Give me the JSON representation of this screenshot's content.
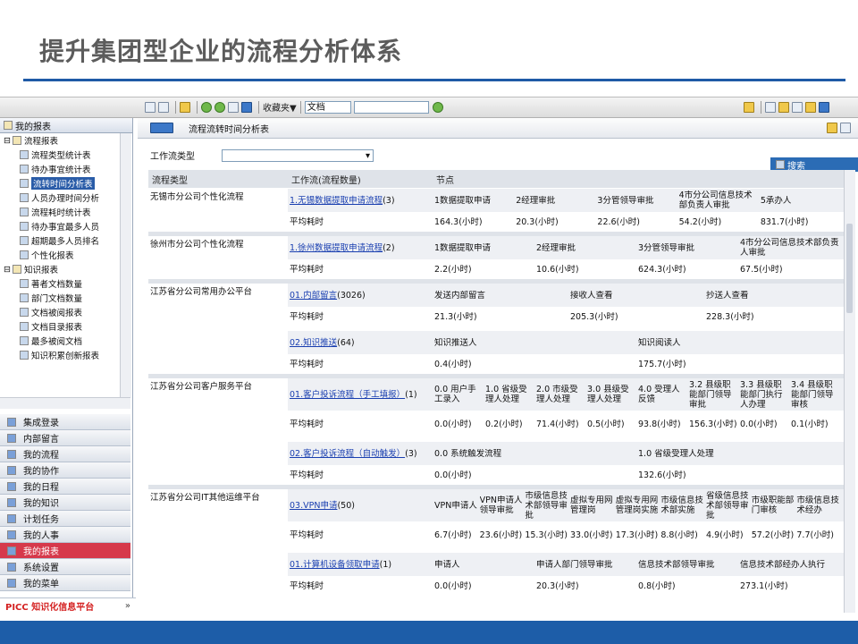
{
  "slide": {
    "title": "提升集团型企业的流程分析体系"
  },
  "toolbar": {
    "favorites": "收藏夹▼",
    "doc_select": "文档"
  },
  "sidebar": {
    "header": "我的报表",
    "tree": [
      {
        "label": "流程报表",
        "indent": 0,
        "icon": "folder-icon"
      },
      {
        "label": "流程类型统计表",
        "indent": 1,
        "icon": "chart-icon"
      },
      {
        "label": "待办事宜统计表",
        "indent": 1,
        "icon": "todo-icon"
      },
      {
        "label": "流转时间分析表",
        "indent": 1,
        "icon": "report-icon",
        "selected": true
      },
      {
        "label": "人员办理时间分析",
        "indent": 1,
        "icon": "user-icon"
      },
      {
        "label": "流程耗时统计表",
        "indent": 1,
        "icon": "report-icon"
      },
      {
        "label": "待办事宜最多人员",
        "indent": 1,
        "icon": "todo-icon"
      },
      {
        "label": "超期最多人员排名",
        "indent": 1,
        "icon": "user-icon"
      },
      {
        "label": "个性化报表",
        "indent": 1,
        "icon": "report-icon"
      },
      {
        "label": "知识报表",
        "indent": 0,
        "icon": "folder-icon"
      },
      {
        "label": "著者文档数量",
        "indent": 1,
        "icon": "user-icon"
      },
      {
        "label": "部门文档数量",
        "indent": 1,
        "icon": "group-icon"
      },
      {
        "label": "文档被阅报表",
        "indent": 1,
        "icon": "report-icon"
      },
      {
        "label": "文档目录报表",
        "indent": 1,
        "icon": "list-icon"
      },
      {
        "label": "最多被阅文档",
        "indent": 1,
        "icon": "report-icon"
      },
      {
        "label": "知识积累创新报表",
        "indent": 1,
        "icon": "report-icon"
      }
    ],
    "nav": [
      {
        "label": "集成登录",
        "active": false
      },
      {
        "label": "内部留言",
        "active": false
      },
      {
        "label": "我的流程",
        "active": false
      },
      {
        "label": "我的协作",
        "active": false
      },
      {
        "label": "我的日程",
        "active": false
      },
      {
        "label": "我的知识",
        "active": false
      },
      {
        "label": "计划任务",
        "active": false
      },
      {
        "label": "我的人事",
        "active": false
      },
      {
        "label": "我的报表",
        "active": true
      },
      {
        "label": "系统设置",
        "active": false
      },
      {
        "label": "我的菜单",
        "active": false
      }
    ],
    "brand": "PICC 知识化信息平台",
    "brand_arrow": "»"
  },
  "main": {
    "title": "流程流转时间分析表",
    "filter_label": "工作流类型",
    "search_label": "搜索",
    "columns": [
      "流程类型",
      "工作流(流程数量)",
      "节点"
    ],
    "groups": [
      {
        "type": "无锡市分公司个性化流程",
        "workflows": [
          {
            "name": "1.无锡数据提取申请流程",
            "count": "(3)",
            "nodes": [
              "1数据提取申请",
              "2经理审批",
              "3分管领导审批",
              "4市分公司信息技术部负责人审批",
              "5承办人"
            ],
            "avg_label": "平均耗时",
            "times": [
              "164.3(小时)",
              "20.3(小时)",
              "22.6(小时)",
              "54.2(小时)",
              "831.7(小时)"
            ]
          }
        ]
      },
      {
        "type": "徐州市分公司个性化流程",
        "workflows": [
          {
            "name": "1.徐州数据提取申请流程",
            "count": "(2)",
            "nodes": [
              "1数据提取申请",
              "2经理审批",
              "3分管领导审批",
              "4市分公司信息技术部负责人审批"
            ],
            "avg_label": "平均耗时",
            "times": [
              "2.2(小时)",
              "10.6(小时)",
              "624.3(小时)",
              "67.5(小时)"
            ]
          }
        ]
      },
      {
        "type": "江苏省分公司常用办公平台",
        "workflows": [
          {
            "name": "01.内部留言",
            "count": "(3026)",
            "nodes": [
              "发送内部留言",
              "接收人查看",
              "抄送人查看"
            ],
            "avg_label": "平均耗时",
            "times": [
              "21.3(小时)",
              "205.3(小时)",
              "228.3(小时)"
            ]
          },
          {
            "name": "02.知识推送",
            "count": "(64)",
            "nodes": [
              "知识推送人",
              "知识阅读人"
            ],
            "avg_label": "平均耗时",
            "times": [
              "0.4(小时)",
              "175.7(小时)"
            ]
          }
        ]
      },
      {
        "type": "江苏省分公司客户服务平台",
        "workflows": [
          {
            "name": "01.客户投诉流程（手工填报）",
            "count": "(1)",
            "nodes": [
              "0.0 用户手工录入",
              "1.0 省级受理人处理",
              "2.0 市级受理人处理",
              "3.0 县级受理人处理",
              "4.0 受理人反馈",
              "3.2 县级职能部门领导审批",
              "3.3 县级职能部门执行人办理",
              "3.4 县级职能部门领导审核"
            ],
            "avg_label": "平均耗时",
            "times": [
              "0.0(小时)",
              "0.2(小时)",
              "71.4(小时)",
              "0.5(小时)",
              "93.8(小时)",
              "156.3(小时)",
              "0.0(小时)",
              "0.1(小时)"
            ]
          },
          {
            "name": "02.客户投诉流程（自动触发）",
            "count": "(3)",
            "nodes": [
              "0.0 系统触发流程",
              "1.0 省级受理人处理"
            ],
            "avg_label": "平均耗时",
            "times": [
              "0.0(小时)",
              "132.6(小时)"
            ]
          }
        ]
      },
      {
        "type": "江苏省分公司IT其他运维平台",
        "workflows": [
          {
            "name": "03.VPN申请",
            "count": "(50)",
            "nodes": [
              "VPN申请人",
              "VPN申请人领导审批",
              "市级信息技术部领导审批",
              "虚拟专用网管理岗",
              "虚拟专用网管理岗实施",
              "市级信息技术部实施",
              "省级信息技术部领导审批",
              "市级职能部门审核",
              "市级信息技术经办"
            ],
            "avg_label": "平均耗时",
            "times": [
              "6.7(小时)",
              "23.6(小时)",
              "15.3(小时)",
              "33.0(小时)",
              "17.3(小时)",
              "8.8(小时)",
              "4.9(小时)",
              "57.2(小时)",
              "7.7(小时)"
            ]
          },
          {
            "name": "01.计算机设备领取申请",
            "count": "(1)",
            "nodes": [
              "申请人",
              "申请人部门领导审批",
              "信息技术部领导审批",
              "信息技术部经办人执行"
            ],
            "avg_label": "平均耗时",
            "times": [
              "0.0(小时)",
              "20.3(小时)",
              "0.8(小时)",
              "273.1(小时)"
            ]
          }
        ]
      }
    ]
  }
}
